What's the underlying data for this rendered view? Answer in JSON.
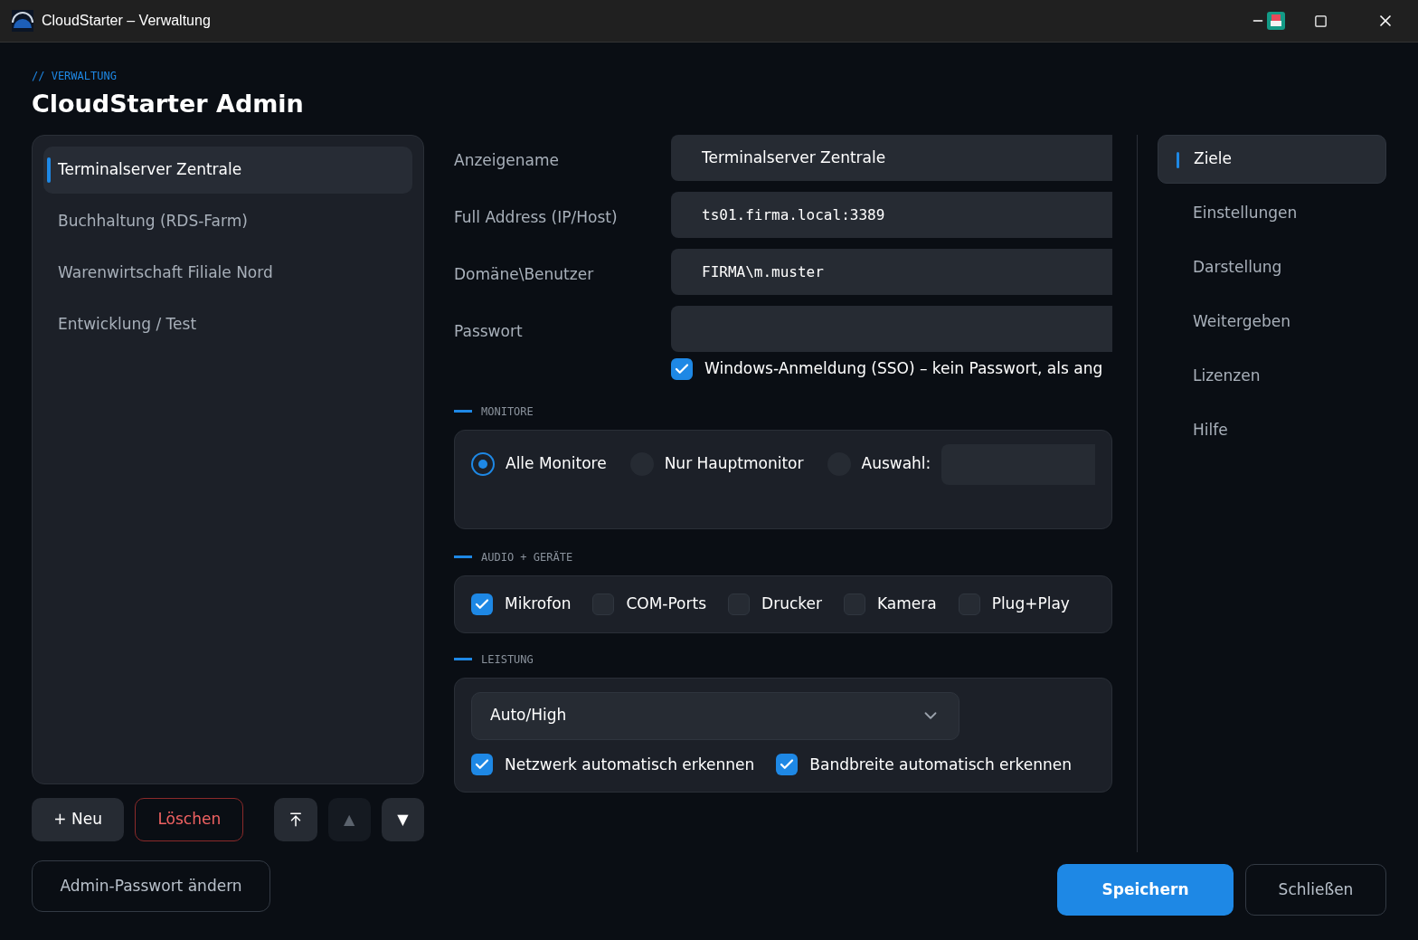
{
  "window": {
    "title": "CloudStarter – Verwaltung"
  },
  "header": {
    "eyebrow": "// VERWALTUNG",
    "title": "CloudStarter Admin"
  },
  "connections": [
    {
      "label": "Terminalserver Zentrale",
      "selected": true
    },
    {
      "label": "Buchhaltung (RDS-Farm)",
      "selected": false
    },
    {
      "label": "Warenwirtschaft Filiale Nord",
      "selected": false
    },
    {
      "label": "Entwicklung / Test",
      "selected": false
    }
  ],
  "list_buttons": [
    {
      "kind": "new",
      "label": "+ Neu",
      "disabled": false
    },
    {
      "kind": "delete",
      "label": "Löschen",
      "disabled": false
    },
    {
      "kind": "top",
      "disabled": false
    },
    {
      "kind": "glyph",
      "label": "▲",
      "disabled": true
    },
    {
      "kind": "glyph",
      "label": "▼",
      "disabled": false
    }
  ],
  "admin_password_button": "Admin-Passwort ändern",
  "fields": [
    {
      "label": "Anzeigename",
      "value": "Terminalserver Zentrale",
      "mono": false
    },
    {
      "label": "Full Address (IP/Host)",
      "value": "ts01.firma.local:3389",
      "mono": true
    },
    {
      "label": "Domäne\\Benutzer",
      "value": "FIRMA\\m.muster",
      "mono": true
    },
    {
      "label": "Passwort"
    }
  ],
  "sso": {
    "label": "Windows-Anmeldung (SSO) – kein Passwort, als ang",
    "checked": true
  },
  "monitors": {
    "heading": "MONITORE",
    "options": [
      {
        "label": "Alle Monitore",
        "selected": true
      },
      {
        "label": "Nur Hauptmonitor",
        "selected": false
      },
      {
        "label": "Auswahl:",
        "selected": false
      }
    ]
  },
  "devices": {
    "heading": "AUDIO + GERÄTE",
    "items": [
      {
        "label": "Mikrofon",
        "checked": true
      },
      {
        "label": "COM-Ports",
        "checked": false
      },
      {
        "label": "Drucker",
        "checked": false
      },
      {
        "label": "Kamera",
        "checked": false
      },
      {
        "label": "Plug+Play",
        "checked": false
      }
    ]
  },
  "performance": {
    "heading": "LEISTUNG",
    "dropdown": "Auto/High",
    "options": [
      {
        "label": "Netzwerk automatisch erkennen",
        "checked": true
      },
      {
        "label": "Bandbreite automatisch erkennen",
        "checked": true
      }
    ]
  },
  "nav": [
    {
      "label": "Ziele",
      "selected": true
    },
    {
      "label": "Einstellungen",
      "selected": false
    },
    {
      "label": "Darstellung",
      "selected": false
    },
    {
      "label": "Weitergeben",
      "selected": false
    },
    {
      "label": "Lizenzen",
      "selected": false
    },
    {
      "label": "Hilfe",
      "selected": false
    }
  ],
  "footer": {
    "save": "Speichern",
    "close": "Schließen"
  }
}
